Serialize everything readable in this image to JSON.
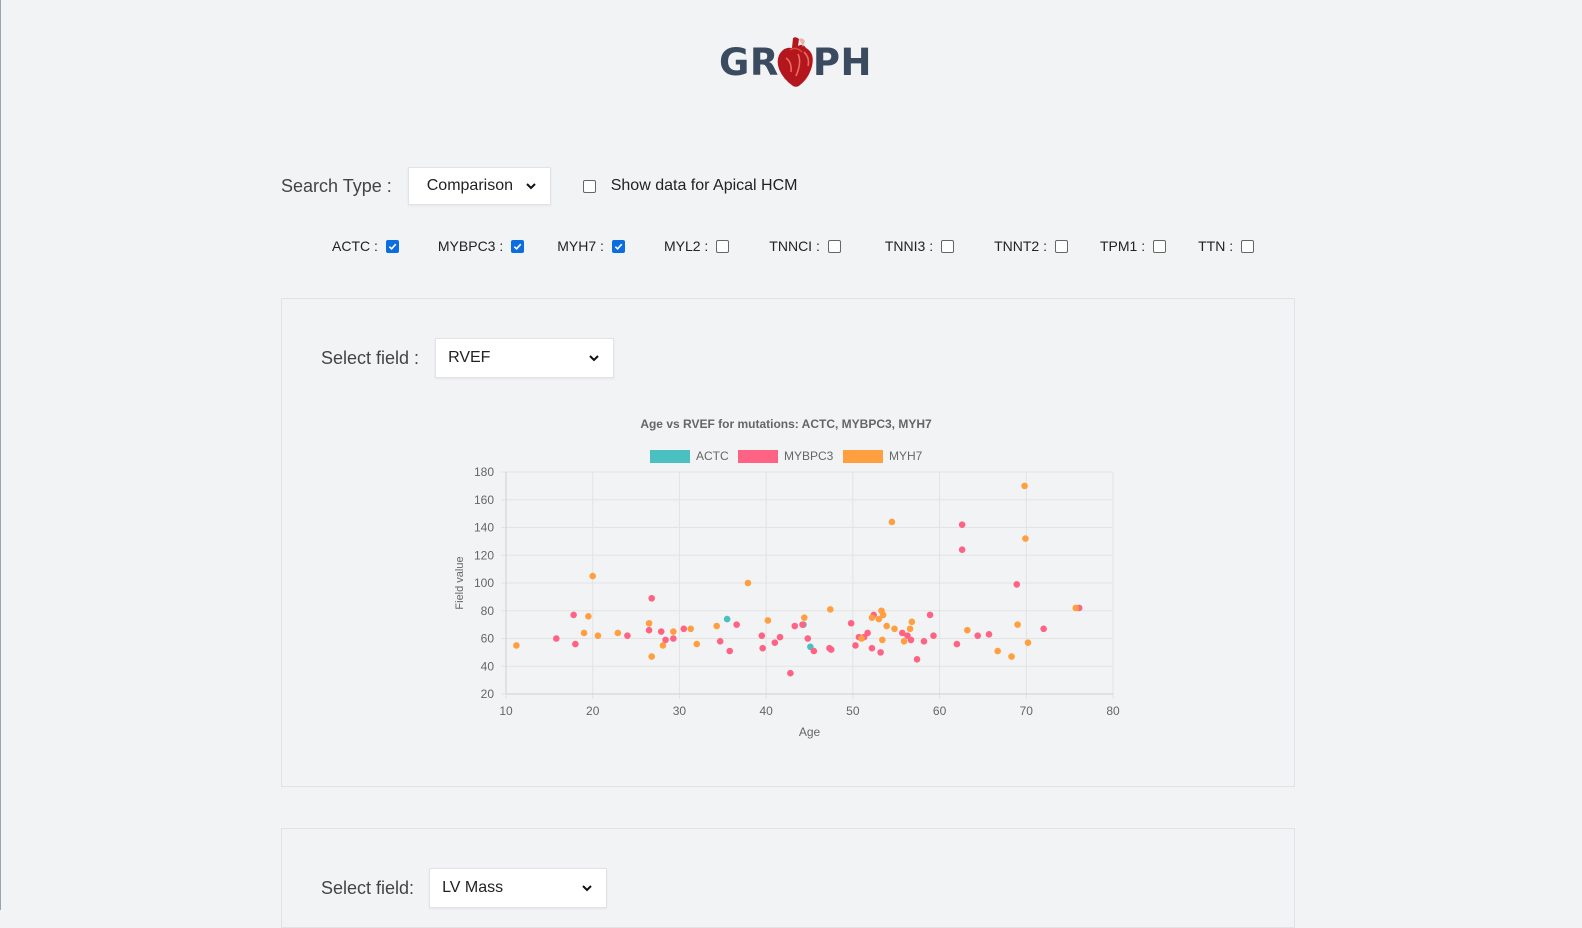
{
  "logo": {
    "left": "GR",
    "right": "PH"
  },
  "search": {
    "label": "Search Type :",
    "selected": "Comparison",
    "apical_label": "Show data for Apical HCM",
    "apical_checked": false
  },
  "genes": [
    {
      "label": "ACTC :",
      "checked": true
    },
    {
      "label": "MYBPC3 :",
      "checked": true
    },
    {
      "label": "MYH7 :",
      "checked": true
    },
    {
      "label": "MYL2 :",
      "checked": false
    },
    {
      "label": "TNNCI :",
      "checked": false
    },
    {
      "label": "TNNI3 :",
      "checked": false
    },
    {
      "label": "TNNT2 :",
      "checked": false
    },
    {
      "label": "TPM1 :",
      "checked": false
    },
    {
      "label": "TTN :",
      "checked": false
    }
  ],
  "panel1": {
    "label": "Select field :",
    "selected": "RVEF"
  },
  "panel2": {
    "label": "Select field:",
    "selected": "LV Mass"
  },
  "colors": {
    "actc": "#4bc0c0",
    "mybpc3": "#ff6384",
    "myh7": "#ff9f40",
    "check": "#0b6de0"
  },
  "chart_data": {
    "type": "scatter",
    "title": "Age vs RVEF for mutations: ACTC, MYBPC3, MYH7",
    "xlabel": "Age",
    "ylabel": "Field value",
    "xlim": [
      10,
      80
    ],
    "ylim": [
      20,
      180
    ],
    "xticks": [
      10,
      20,
      30,
      40,
      50,
      60,
      70,
      80
    ],
    "yticks": [
      20,
      40,
      60,
      80,
      100,
      120,
      140,
      160,
      180
    ],
    "legend_position": "top",
    "grid": true,
    "series": [
      {
        "name": "ACTC",
        "color": "#4bc0c0",
        "points": [
          [
            35.5,
            74
          ],
          [
            44.3,
            70
          ],
          [
            45.1,
            54
          ]
        ]
      },
      {
        "name": "MYBPC3",
        "color": "#ff6384",
        "points": [
          [
            15.8,
            60
          ],
          [
            17.8,
            77
          ],
          [
            18,
            56
          ],
          [
            24,
            62
          ],
          [
            26.5,
            66
          ],
          [
            26.8,
            89
          ],
          [
            27.9,
            65
          ],
          [
            28.4,
            59
          ],
          [
            29.3,
            60
          ],
          [
            30.5,
            67
          ],
          [
            34.7,
            58
          ],
          [
            35.8,
            51
          ],
          [
            36.6,
            70
          ],
          [
            39.5,
            62
          ],
          [
            39.6,
            53
          ],
          [
            41,
            57
          ],
          [
            41.6,
            61
          ],
          [
            42.8,
            35
          ],
          [
            43.3,
            69
          ],
          [
            44.2,
            70
          ],
          [
            44.8,
            60
          ],
          [
            45.5,
            51
          ],
          [
            47.3,
            53
          ],
          [
            47.5,
            52
          ],
          [
            49.8,
            71
          ],
          [
            50.3,
            55
          ],
          [
            50.7,
            61
          ],
          [
            51.3,
            61
          ],
          [
            51.7,
            64
          ],
          [
            52.2,
            53
          ],
          [
            52.4,
            77
          ],
          [
            53.2,
            50
          ],
          [
            55.7,
            64
          ],
          [
            56.3,
            62
          ],
          [
            56.7,
            59
          ],
          [
            57.4,
            45
          ],
          [
            58.2,
            58
          ],
          [
            59.3,
            62
          ],
          [
            58.9,
            77
          ],
          [
            62,
            56
          ],
          [
            62.6,
            142
          ],
          [
            62.6,
            124
          ],
          [
            64.4,
            62
          ],
          [
            65.7,
            63
          ],
          [
            68.9,
            99
          ],
          [
            72,
            67
          ],
          [
            76.1,
            82
          ]
        ]
      },
      {
        "name": "MYH7",
        "color": "#ff9f40",
        "points": [
          [
            11.2,
            55
          ],
          [
            19,
            64
          ],
          [
            19.5,
            76
          ],
          [
            20,
            105
          ],
          [
            20.6,
            62
          ],
          [
            22.9,
            64
          ],
          [
            26.5,
            71
          ],
          [
            26.8,
            47
          ],
          [
            28.1,
            55
          ],
          [
            29.3,
            65
          ],
          [
            31.3,
            67
          ],
          [
            32,
            56
          ],
          [
            34.3,
            69
          ],
          [
            37.9,
            100
          ],
          [
            40.2,
            73
          ],
          [
            44.4,
            75
          ],
          [
            47.4,
            81
          ],
          [
            51,
            60
          ],
          [
            52.2,
            75
          ],
          [
            53,
            74
          ],
          [
            53.3,
            80
          ],
          [
            53.5,
            77
          ],
          [
            53.4,
            59
          ],
          [
            53.9,
            69
          ],
          [
            54.5,
            144
          ],
          [
            54.8,
            67
          ],
          [
            55.9,
            58
          ],
          [
            56.6,
            67
          ],
          [
            56.8,
            72
          ],
          [
            63.2,
            66
          ],
          [
            66.7,
            51
          ],
          [
            68.3,
            47
          ],
          [
            69,
            70
          ],
          [
            69.8,
            170
          ],
          [
            69.9,
            132
          ],
          [
            70.2,
            57
          ],
          [
            75.7,
            82
          ]
        ]
      }
    ]
  }
}
